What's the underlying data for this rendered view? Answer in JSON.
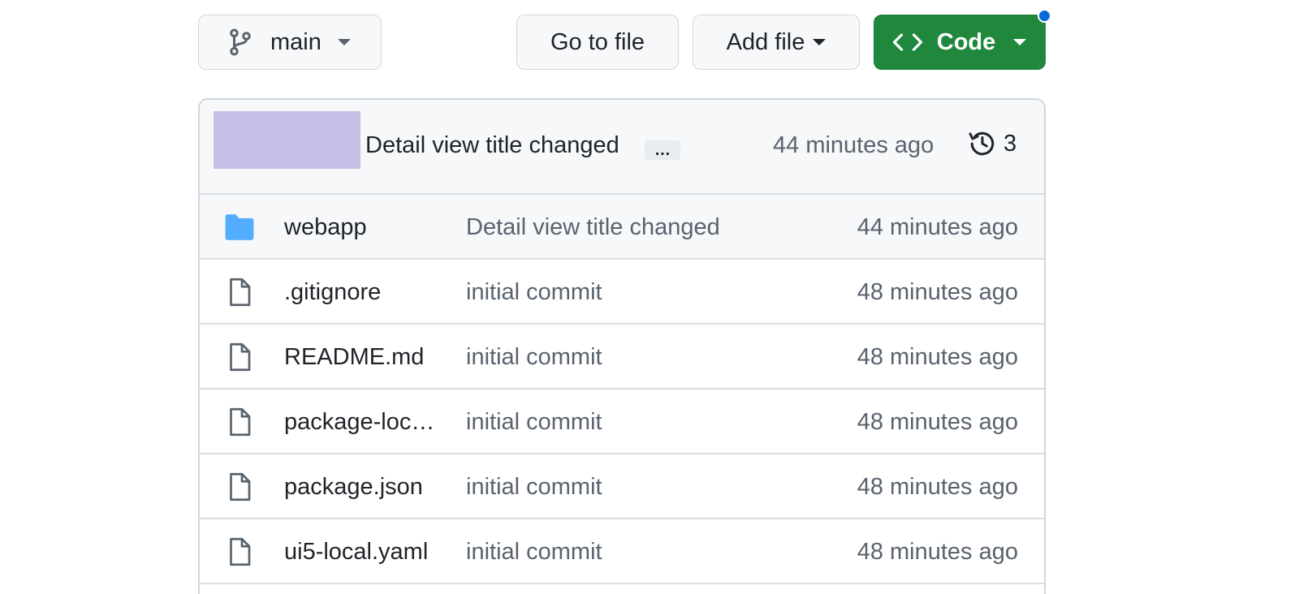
{
  "toolbar": {
    "branch_label": "main",
    "go_to_file_label": "Go to file",
    "add_file_label": "Add file",
    "code_label": "Code"
  },
  "latest_commit": {
    "message": "Detail view title changed",
    "ellipsis": "…",
    "time": "44 minutes ago",
    "history_count": "3"
  },
  "files": [
    {
      "type": "folder",
      "name": "webapp",
      "message": "Detail view title changed",
      "time": "44 minutes ago"
    },
    {
      "type": "file",
      "name": ".gitignore",
      "message": "initial commit",
      "time": "48 minutes ago"
    },
    {
      "type": "file",
      "name": "README.md",
      "message": "initial commit",
      "time": "48 minutes ago"
    },
    {
      "type": "file",
      "name": "package-loc…",
      "message": "initial commit",
      "time": "48 minutes ago"
    },
    {
      "type": "file",
      "name": "package.json",
      "message": "initial commit",
      "time": "48 minutes ago"
    },
    {
      "type": "file",
      "name": "ui5-local.yaml",
      "message": "initial commit",
      "time": "48 minutes ago"
    }
  ],
  "colors": {
    "code_button": "#1f883d",
    "folder_icon": "#54aeff",
    "avatar_placeholder": "#c6bfe5",
    "notification_dot": "#0969da"
  },
  "icons": {
    "branch": "git-branch-icon",
    "code": "code-brackets-icon",
    "history": "history-clock-icon",
    "folder": "folder-icon",
    "file": "file-icon"
  }
}
